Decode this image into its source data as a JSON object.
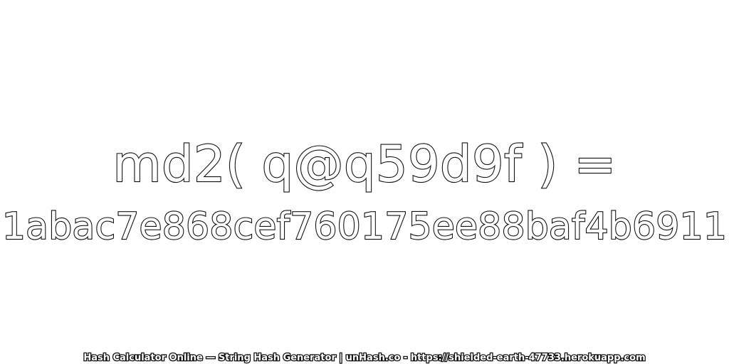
{
  "expression": "md2( q@q59d9f ) =",
  "hash_value": "1abac7e868cef760175ee88baf4b6911",
  "footer": "Hash Calculator Online — String Hash Generator | unHash.co - https://shielded-earth-47733.herokuapp.com",
  "colors": {
    "background": "#ffffff",
    "text_fill": "#ffffff",
    "text_outline": "#111111"
  }
}
